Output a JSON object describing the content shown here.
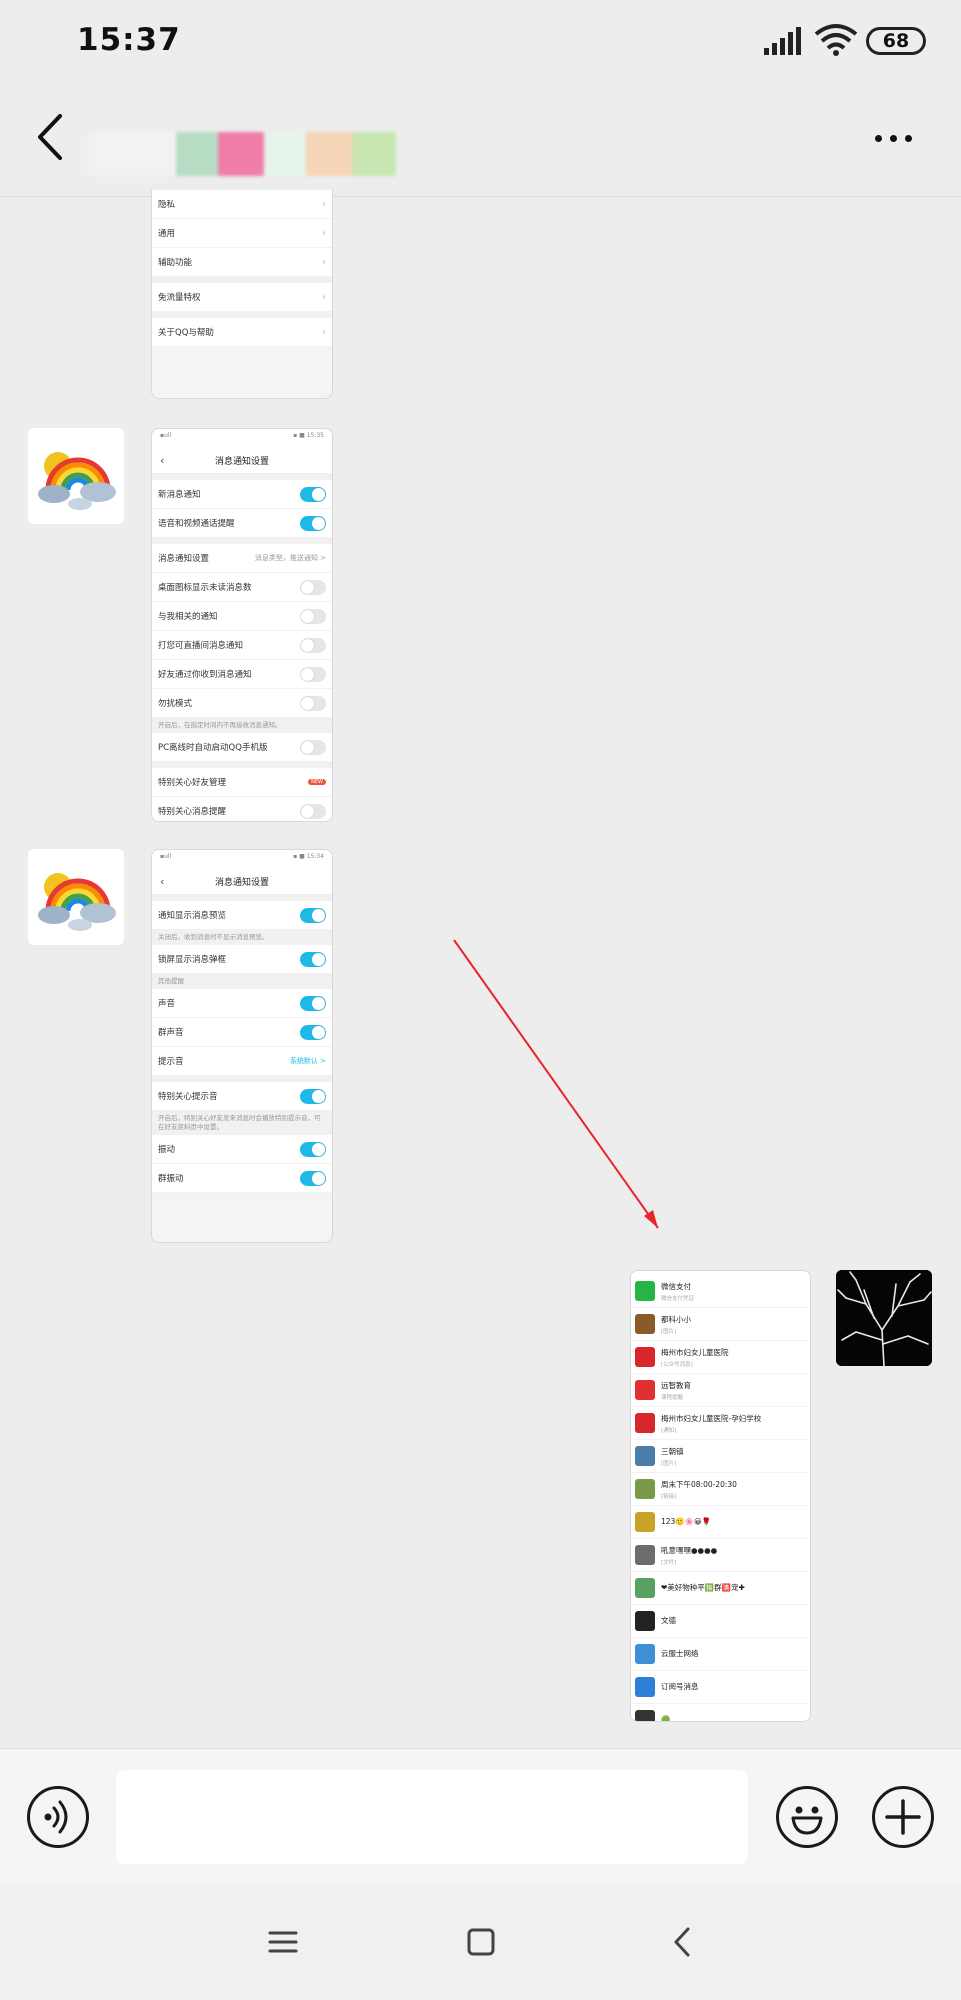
{
  "status_bar": {
    "time": "15:37",
    "battery": "68"
  },
  "header": {
    "back_icon": "chevron-left-icon",
    "more_icon": "more-dots-icon"
  },
  "screenshot1": {
    "rows": [
      {
        "label": "隐私"
      },
      {
        "label": "通用"
      },
      {
        "label": "辅助功能"
      },
      {
        "label": "免流量特权"
      },
      {
        "label": "关于QQ与帮助"
      }
    ]
  },
  "screenshot2": {
    "title": "消息通知设置",
    "rows": [
      {
        "label": "新消息通知",
        "on": true
      },
      {
        "label": "语音和视频通话提醒",
        "on": true
      },
      {
        "label": "消息通知设置",
        "extra": "消息类型，推送通知 >"
      },
      {
        "label": "桌面图标显示未读消息数",
        "on": false
      },
      {
        "label": "与我相关的通知",
        "on": false
      },
      {
        "label": "打您可直播间消息通知",
        "on": false
      },
      {
        "label": "好友通过你收到消息通知",
        "on": false
      },
      {
        "label": "勿扰模式",
        "on": false
      },
      {
        "label": "PC离线时自动启动QQ手机版",
        "on": false
      },
      {
        "label": "特别关心好友管理",
        "new": "NEW"
      },
      {
        "label": "特别关心消息提醒",
        "on": false
      }
    ],
    "note": "开启后，在指定时间内不再接收消息通知。"
  },
  "screenshot3": {
    "title": "消息通知设置",
    "rows": [
      {
        "label": "通知显示消息预览",
        "on": true
      },
      {
        "label": "锁屏显示消息弹框",
        "on": true
      },
      {
        "label": "声音",
        "on": true
      },
      {
        "label": "群声音",
        "on": true
      },
      {
        "label": "提示音",
        "extra": "系统默认 >"
      },
      {
        "label": "特别关心提示音",
        "on": true
      },
      {
        "label": "振动",
        "on": true
      },
      {
        "label": "群振动",
        "on": true
      }
    ],
    "note1": "关闭后，收到消息时不显示消息预览。",
    "section": "其他提醒",
    "note2": "开启后，特别关心好友发来消息时会播放特别提示音，可在好友资料页中设置。"
  },
  "screenshot4": {
    "chats": [
      {
        "name": "微信支付",
        "preview": "微信支付凭证",
        "time": "",
        "color": "#26b545"
      },
      {
        "name": "都科小小",
        "preview": "[图片]",
        "time": "",
        "color": "#8a5a2a"
      },
      {
        "name": "梅州市妇女儿童医院",
        "preview": "[公众号消息]",
        "time": "",
        "color": "#d7262c"
      },
      {
        "name": "远智教育",
        "preview": "课程提醒",
        "time": "",
        "color": "#e03030"
      },
      {
        "name": "梅州市妇女儿童医院-孕妇学校",
        "preview": "[通知]",
        "time": "",
        "color": "#d7262c"
      },
      {
        "name": "三朝镇",
        "preview": "[图片]",
        "time": "",
        "color": "#4a7ea8"
      },
      {
        "name": "周末下午08:00-20:30",
        "preview": "[链接]",
        "time": "",
        "color": "#7a9a4a"
      },
      {
        "name": "123🙂🌸😀🌹",
        "preview": "",
        "time": "",
        "color": "#c9a227"
      },
      {
        "name": "吼意嘿嘿●●●●",
        "preview": "[文件]",
        "time": "",
        "color": "#6d6d6d"
      },
      {
        "name": "❤美好物种平🈯群🈵宠✚",
        "preview": "",
        "time": "",
        "color": "#5aa060"
      },
      {
        "name": "文德",
        "preview": "",
        "time": "",
        "color": "#222222"
      },
      {
        "name": "云服士网络",
        "preview": "",
        "time": "",
        "color": "#3d8fd6"
      },
      {
        "name": "订阅号消息",
        "preview": "",
        "time": "",
        "color": "#2e7fd6"
      },
      {
        "name": "🟢",
        "preview": "",
        "time": "",
        "color": "#333333"
      }
    ]
  },
  "input_bar": {
    "placeholder": "",
    "voice_icon": "voice-icon",
    "emoji_icon": "emoji-icon",
    "plus_icon": "plus-icon"
  },
  "nav_bar": {
    "menu_icon": "menu-icon",
    "home_icon": "home-square-icon",
    "back_icon": "back-triangle-icon"
  },
  "colors": {
    "toggle_on": "#1fb9e8",
    "arrow": "#e8262a",
    "background": "#ededed"
  }
}
